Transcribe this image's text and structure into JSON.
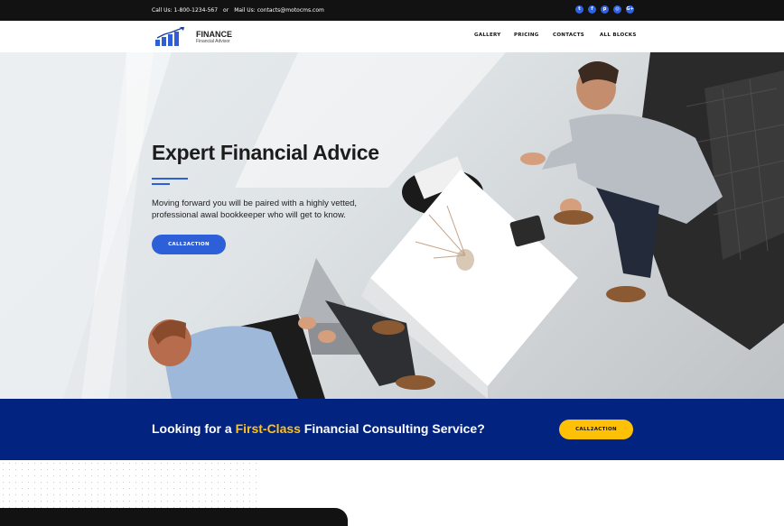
{
  "topbar": {
    "call": "Call Us: 1-800-1234-567",
    "or": "or",
    "mail": "Mail Us: contacts@motocms.com",
    "socials": [
      "twitter-icon",
      "facebook-icon",
      "pinterest-icon",
      "instagram-icon",
      "google-plus-icon"
    ],
    "social_glyphs": [
      "t",
      "f",
      "p",
      "◎",
      "G+"
    ]
  },
  "brand": {
    "title": "FINANCE",
    "subtitle": "Financial Advisor"
  },
  "menu": [
    "GALLERY",
    "PRICING",
    "CONTACTS",
    "ALL BLOCKS"
  ],
  "hero": {
    "heading": "Expert Financial Advice",
    "text": "Moving forward you will be paired with a highly vetted, professional awal bookkeeper who will get to know.",
    "cta": "CALL2ACTION"
  },
  "band": {
    "before": "Looking for a ",
    "highlight": "First-Class",
    "after": " Financial Consulting Service?",
    "cta": "CALL2ACTION"
  },
  "colors": {
    "accent_blue": "#2d5fd8",
    "band_navy": "#02237f",
    "highlight_yellow": "#ffc21d",
    "topbar": "#121212"
  }
}
